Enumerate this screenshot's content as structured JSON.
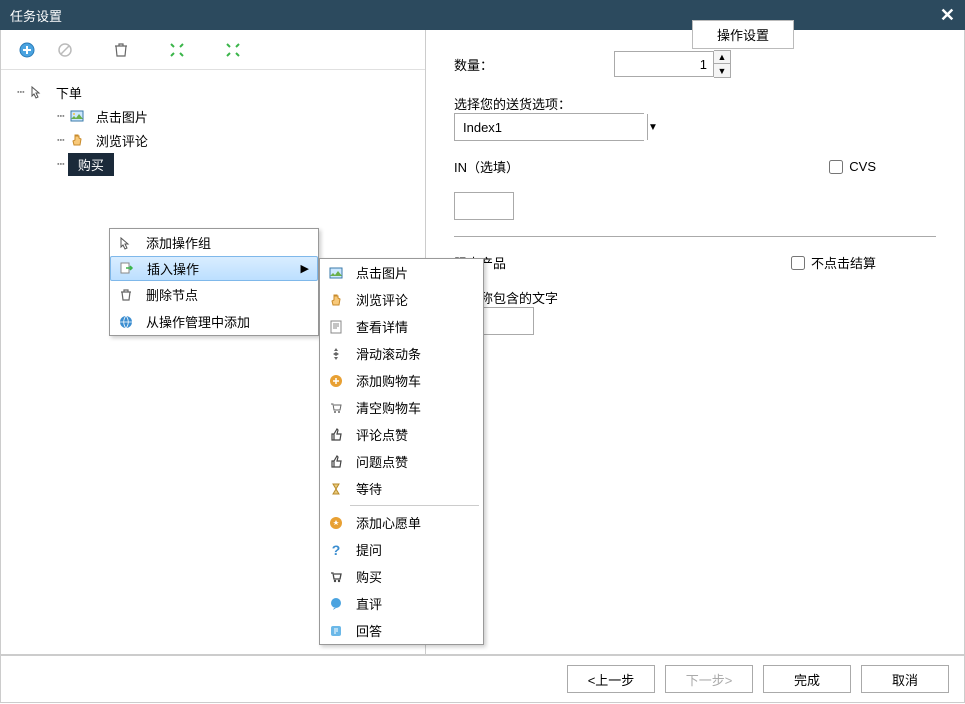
{
  "titlebar": {
    "title": "任务设置"
  },
  "tree": {
    "root": "下单",
    "children": [
      "点击图片",
      "浏览评论",
      "购买"
    ],
    "selected_index": 2
  },
  "context_menu": {
    "items": [
      {
        "label": "添加操作组"
      },
      {
        "label": "插入操作",
        "highlighted": true,
        "has_submenu": true
      },
      {
        "label": "删除节点"
      },
      {
        "label": "从操作管理中添加"
      }
    ]
  },
  "submenu": {
    "groups": [
      [
        "点击图片",
        "浏览评论",
        "查看详情",
        "滑动滚动条",
        "添加购物车",
        "清空购物车",
        "评论点赞",
        "问题点赞",
        "等待"
      ],
      [
        "添加心愿单",
        "提问",
        "购买",
        "直评",
        "回答"
      ]
    ]
  },
  "op_settings": {
    "title": "操作设置",
    "qty_label": "数量：",
    "qty_value": "1",
    "shipping_label": "选择您的送货选项：",
    "shipping_value": "Index1",
    "asin_label": "IN（选填）",
    "cvs_label": "CVS",
    "limited_label": "限卖产品",
    "no_checkout_label": "不点击结算",
    "seller_name_label": "家名称包含的文字"
  },
  "footer": {
    "prev": "<上一步",
    "next": "下一步>",
    "finish": "完成",
    "cancel": "取消"
  }
}
